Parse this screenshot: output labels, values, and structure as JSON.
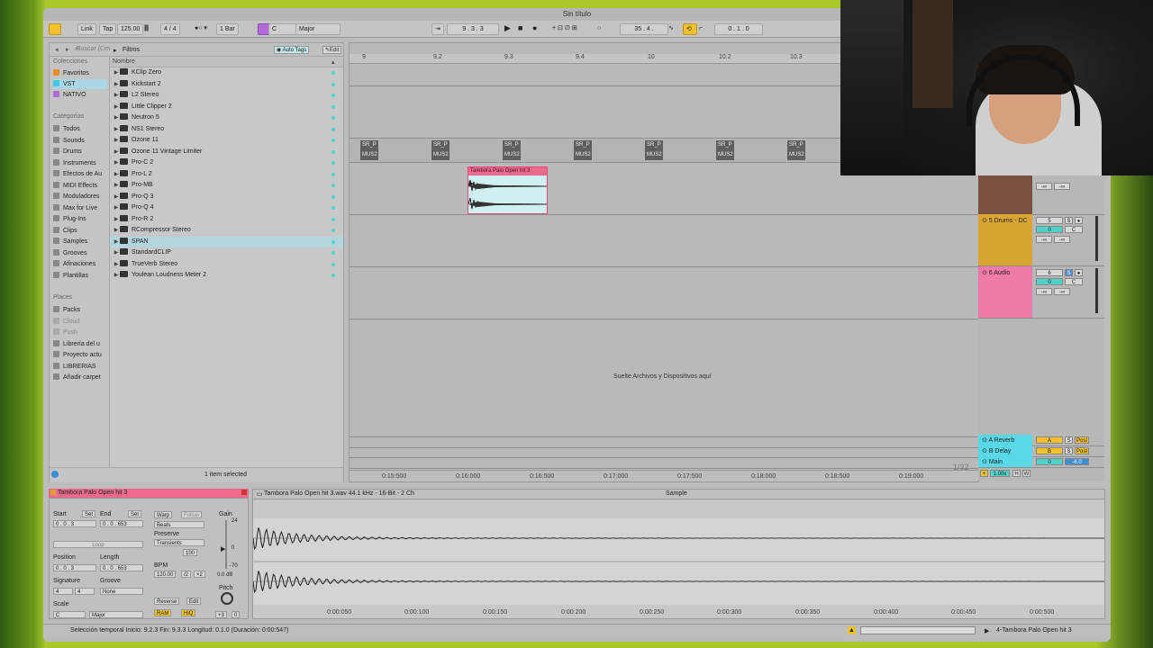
{
  "window": {
    "title": "Sin título"
  },
  "transport": {
    "link": "Link",
    "tap": "Tap",
    "tempo": "125.00",
    "time_signature": "4 / 4",
    "quantize": "1 Bar",
    "key": "C",
    "scale": "Major",
    "position": "9 .  3 .  3",
    "loop_start": "35 .  4 .",
    "loop_length": "0 .  1 .  0"
  },
  "browser": {
    "search_placeholder": "Buscar (Cmd + F)",
    "filters_label": "Filtros",
    "auto_tags_label": "Auto Tags",
    "edit_label": "Edit",
    "name_header": "Nombre",
    "status": "1 item selected",
    "collections_header": "Colecciones",
    "collections": [
      {
        "label": "Favoritos",
        "color": "#f08c2a"
      },
      {
        "label": "VST",
        "color": "#3ec7e0"
      },
      {
        "label": "NATIVO",
        "color": "#b06bd8"
      }
    ],
    "categories_header": "Categorías",
    "categories": [
      "Todos",
      "Sounds",
      "Drums",
      "Instruments",
      "Efectos de Au",
      "MIDI Effects",
      "Moduladores",
      "Max for Live",
      "Plug-Ins",
      "Clips",
      "Samples",
      "Grooves",
      "Afinaciones",
      "Plantillas"
    ],
    "places_header": "Places",
    "places": [
      "Packs",
      "Cloud",
      "Push",
      "Librería del u",
      "Proyecto actu",
      "LIBRERIAS",
      "Añadir carpet"
    ],
    "items": [
      "KClip Zero",
      "Kickstart 2",
      "L2 Stereo",
      "Little Clipper 2",
      "Neutron 5",
      "NS1 Stereo",
      "Ozone 11",
      "Ozone 11 Vintage Limiter",
      "Pro-C 2",
      "Pro-L 2",
      "Pro-MB",
      "Pro-Q 3",
      "Pro-Q 4",
      "Pro-R 2",
      "RCompressor Stereo",
      "SPAN",
      "StandardCLIP",
      "TrueVerb Stereo",
      "Youlean Loudness Meter 2"
    ],
    "selected_item": "SPAN"
  },
  "arrangement": {
    "ruler": [
      "9",
      "9.2",
      "9.3",
      "9.4",
      "10",
      "10.2",
      "10.3"
    ],
    "small_clip_top": "SR_P",
    "small_clip_bottom": "MUS2",
    "clip_title": "Tambora Palo Open hit 3",
    "drop_hint": "Suelte Archivos y Dispositivos aquí",
    "times": [
      "0:15:500",
      "0:16:000",
      "0:16:500",
      "0:17:000",
      "0:17:500",
      "0:18:000",
      "0:18:500",
      "0:19:000"
    ],
    "zoom": "1/32"
  },
  "tracks": [
    {
      "name": "5 Drums - DC",
      "number": "5",
      "color": "#d9a531",
      "vol": "0",
      "pan": "C",
      "inf": "-∞"
    },
    {
      "name": "6 Audio",
      "number": "6",
      "color": "#f07aa8",
      "vol": "0",
      "pan": "C",
      "inf": "-∞"
    }
  ],
  "returns": [
    {
      "name": "A Reverb",
      "letter": "A",
      "post": "Post"
    },
    {
      "name": "B Delay",
      "letter": "B",
      "post": "Post"
    },
    {
      "name": "Main",
      "vol": "0",
      "val": "-6.0"
    }
  ],
  "clip_view": {
    "title": "Tambora Palo Open hit 3",
    "start_label": "Start",
    "end_label": "End",
    "set": "Set",
    "start": "0 .  0 .  3",
    "end": "0 .  0 .  653",
    "warp": "Warp",
    "follow": "Follow",
    "beats": "Beats",
    "preserve": "Preserve",
    "transients": "Transients",
    "hundred": "100",
    "loop": "Loop",
    "position_label": "Position",
    "length_label": "Length",
    "position": "0 .  0 .  3",
    "length": "0 .  0 .  653",
    "bpm_label": "BPM",
    "bpm": "120.00",
    "half": "/2",
    "double": "×2",
    "signature_label": "Signature",
    "groove_label": "Groove",
    "sig_num": "4",
    "sig_den": "4",
    "groove": "None",
    "scale_label": "Scale",
    "scale_key": "C",
    "scale_mode": "Major",
    "gain_label": "Gain",
    "gain_db": "0.0 dB",
    "gain_top": "24",
    "gain_zero": "0",
    "gain_bottom": "-70",
    "reverse": "Reverse",
    "edit": "Edit",
    "ram": "RAM",
    "hiq": "HiQ",
    "pitch_label": "Pitch",
    "pitch": "+3",
    "detune": "0"
  },
  "sample_view": {
    "file_info": "Tambora Palo Open hit 3.wav  44.1 kHz - 16-Bit - 2 Ch",
    "tab": "Sample",
    "times": [
      "0:00:050",
      "0:00:100",
      "0:00:150",
      "0:00:200",
      "0:00:250",
      "0:00:300",
      "0:00:350",
      "0:00:400",
      "0:00:450",
      "0:00:500"
    ]
  },
  "status_bar": {
    "text": "Selección temporal   Inicio: 9.2.3   Fin: 9.3.3   Longitud: 0.1.0   (Duración: 0:00:547)",
    "clip": "4-Tambora Palo Open hit 3"
  },
  "colors": {
    "accent": "#f5c12a",
    "clip_pink": "#f06a8e",
    "teal": "#4fd3c8"
  }
}
